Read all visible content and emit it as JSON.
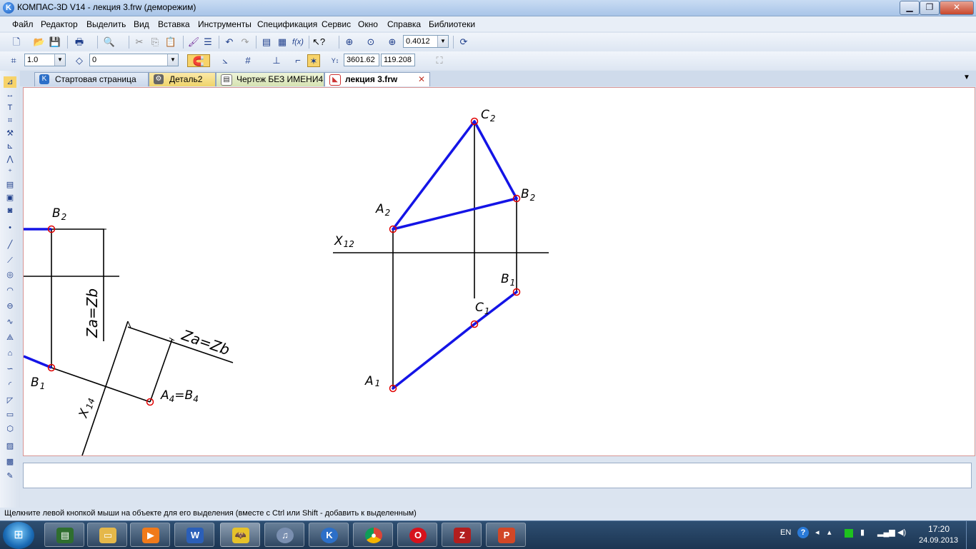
{
  "window": {
    "title": "КОМПАС-3D V14 - лекция 3.frw (деморежим)",
    "minimize": "▁",
    "restore": "❐",
    "close": "✕"
  },
  "menu": [
    "Файл",
    "Редактор",
    "Выделить",
    "Вид",
    "Вставка",
    "Инструменты",
    "Спецификация",
    "Сервис",
    "Окно",
    "Справка",
    "Библиотеки"
  ],
  "toolbar1": {
    "zoom_value": "0.4012",
    "fx_label": "f(x)"
  },
  "toolbar2": {
    "line_scale": "1.0",
    "layer": "0",
    "coord_x": "3601.62",
    "coord_y": "119.208"
  },
  "tabs": [
    {
      "label": "Стартовая страница",
      "icon": "kompas-logo-icon"
    },
    {
      "label": "Деталь2",
      "icon": "part-icon"
    },
    {
      "label": "Чертеж БЕЗ ИМЕНИ4",
      "icon": "drawing-icon"
    },
    {
      "label": "лекция 3.frw",
      "icon": "fragment-icon",
      "close": "✕"
    }
  ],
  "tab_overflow": "▼",
  "drawing": {
    "labels": {
      "left_B2": "B",
      "left_B2_sub": "2",
      "left_B1": "B",
      "left_B1_sub": "1",
      "left_zab": "Za=Zb",
      "right_zab": "Za=Zb",
      "x14": "X",
      "x14_sub": "14",
      "a4b4_a": "A",
      "a4b4_a_sub": "4",
      "a4b4_eq": "=",
      "a4b4_b": "B",
      "a4b4_b_sub": "4",
      "C2": "C",
      "C2_sub": "2",
      "B2": "B",
      "B2_sub": "2",
      "A2": "A",
      "A2_sub": "2",
      "X12": "X",
      "X12_sub": "12",
      "B1": "B",
      "B1_sub": "1",
      "C1": "C",
      "C1_sub": "1",
      "A1": "A",
      "A1_sub": "1"
    },
    "colors": {
      "edge": "#1414e6",
      "line": "#000000",
      "point": "#e00000"
    }
  },
  "status": "Щелкните левой кнопкой мыши на объекте для его выделения (вместе с Ctrl или Shift - добавить к выделенным)",
  "taskbar": {
    "apps": [
      "task-manager",
      "file-explorer",
      "media-player",
      "word",
      "batman",
      "itunes",
      "kompas",
      "chrome",
      "opera",
      "filezilla",
      "powerpoint"
    ],
    "lang": "EN",
    "time": "17:20",
    "date": "24.09.2013"
  }
}
